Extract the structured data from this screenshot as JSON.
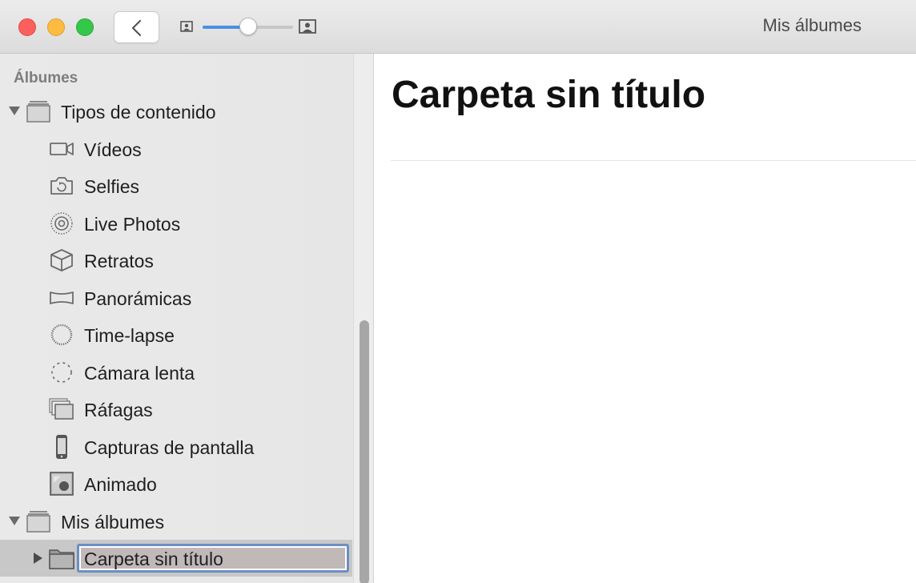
{
  "window": {
    "title": "Mis álbumes"
  },
  "toolbar": {
    "zoom_slider_value": 0.5,
    "accent_color": "#4a90e2"
  },
  "sidebar": {
    "heading": "Álbumes",
    "groups": [
      {
        "label": "Tipos de contenido",
        "expanded": true,
        "icon": "album-stack-icon",
        "items": [
          {
            "label": "Vídeos",
            "icon": "video-camera-icon"
          },
          {
            "label": "Selfies",
            "icon": "selfie-camera-icon"
          },
          {
            "label": "Live Photos",
            "icon": "live-photo-icon"
          },
          {
            "label": "Retratos",
            "icon": "cube-icon"
          },
          {
            "label": "Panorámicas",
            "icon": "panorama-icon"
          },
          {
            "label": "Time-lapse",
            "icon": "timelapse-icon"
          },
          {
            "label": "Cámara lenta",
            "icon": "slow-motion-icon"
          },
          {
            "label": "Ráfagas",
            "icon": "burst-icon"
          },
          {
            "label": "Capturas de pantalla",
            "icon": "phone-icon"
          },
          {
            "label": "Animado",
            "icon": "animated-icon"
          }
        ]
      },
      {
        "label": "Mis álbumes",
        "expanded": true,
        "icon": "album-stack-icon",
        "items": [
          {
            "label": "Carpeta sin título",
            "icon": "folder-icon",
            "editing": true
          }
        ]
      }
    ]
  },
  "main": {
    "title": "Carpeta sin título"
  }
}
